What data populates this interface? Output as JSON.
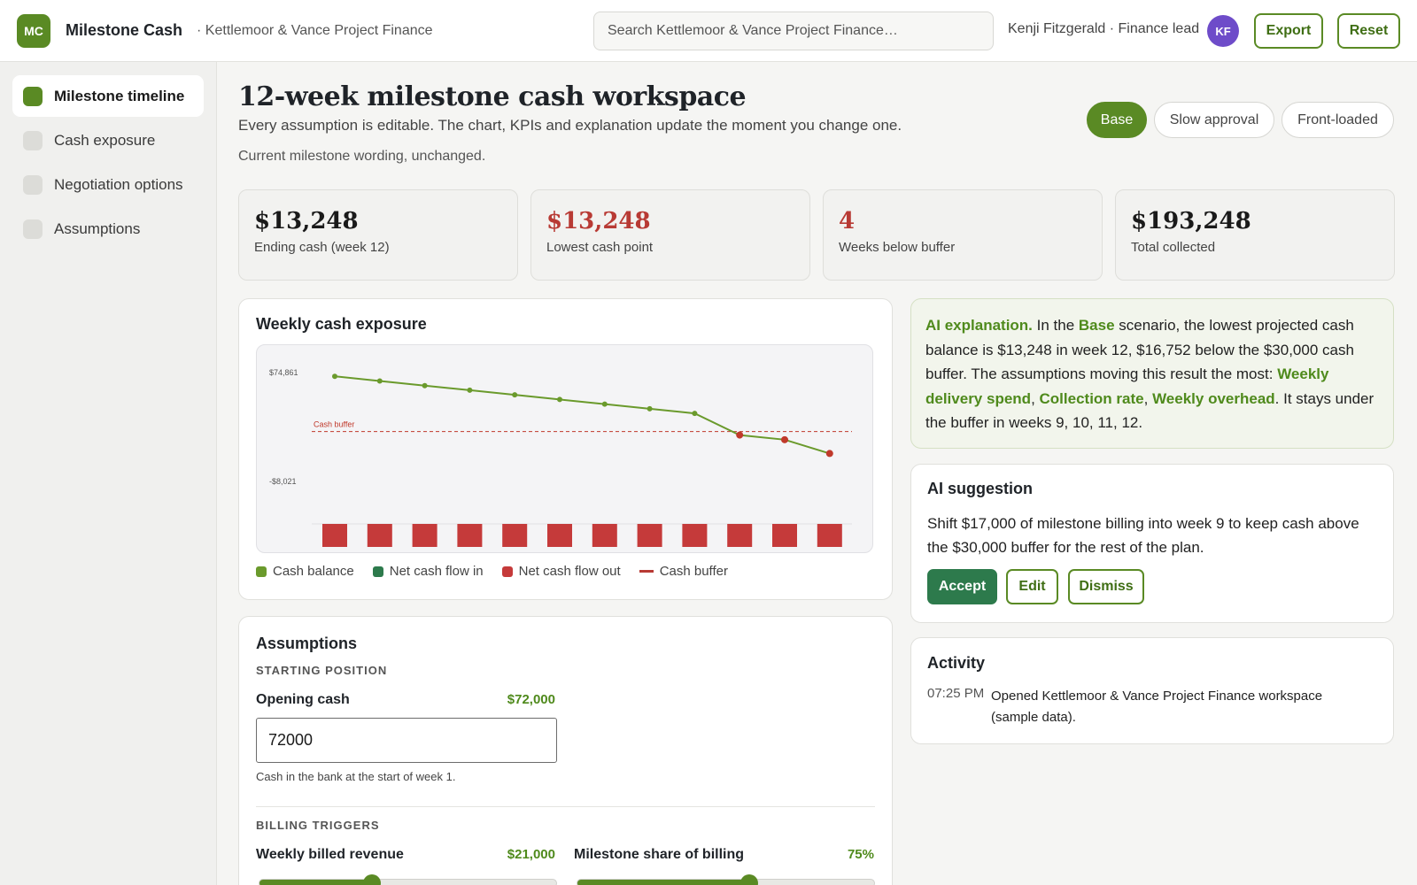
{
  "app": {
    "logo_text": "MC",
    "name": "Milestone Cash",
    "org": "· Kettlemoor & Vance Project Finance",
    "search_placeholder": "Search Kettlemoor & Vance Project Finance…",
    "user": "Kenji Fitzgerald · Finance lead",
    "avatar_initials": "KF",
    "export_label": "Export",
    "reset_label": "Reset"
  },
  "sidebar": {
    "items": [
      {
        "label": "Milestone timeline",
        "active": true
      },
      {
        "label": "Cash exposure",
        "active": false
      },
      {
        "label": "Negotiation options",
        "active": false
      },
      {
        "label": "Assumptions",
        "active": false
      }
    ]
  },
  "header": {
    "title": "12-week milestone cash workspace",
    "subtitle": "Every assumption is editable. The chart, KPIs and explanation update the moment you change one.",
    "note": "Current milestone wording, unchanged."
  },
  "scenarios": [
    {
      "label": "Base",
      "active": true
    },
    {
      "label": "Slow approval",
      "active": false
    },
    {
      "label": "Front-loaded",
      "active": false
    }
  ],
  "kpis": [
    {
      "value": "$13,248",
      "label": "Ending cash (week 12)",
      "tone": "normal"
    },
    {
      "value": "$13,248",
      "label": "Lowest cash point",
      "tone": "red"
    },
    {
      "value": "4",
      "label": "Weeks below buffer",
      "tone": "red"
    },
    {
      "value": "$193,248",
      "label": "Total collected",
      "tone": "normal"
    }
  ],
  "chart_card": {
    "title": "Weekly cash exposure",
    "legend": [
      "Cash balance",
      "Net cash flow in",
      "Net cash flow out",
      "Cash buffer"
    ]
  },
  "chart_data": {
    "type": "line",
    "title": "Weekly cash exposure",
    "x": [
      1,
      2,
      3,
      4,
      5,
      6,
      7,
      8,
      9,
      10,
      11,
      12
    ],
    "series": [
      {
        "name": "Cash balance",
        "values": [
          72000,
          68477,
          64955,
          61432,
          57909,
          54386,
          50864,
          47341,
          43818,
          27295,
          23773,
          13248
        ]
      },
      {
        "name": "Net cash flow out",
        "values": [
          -3523,
          -3523,
          -3523,
          -3523,
          -3523,
          -3523,
          -3523,
          -3523,
          -3523,
          -3523,
          -3523,
          -3523
        ]
      }
    ],
    "buffer": {
      "name": "Cash buffer",
      "value": 30000
    },
    "ytick_labels": [
      "$74,861",
      "-$8,021"
    ],
    "ylim": [
      -8021,
      74861
    ],
    "colors": {
      "balance": "#6a9a2c",
      "below": "#c0392b",
      "out": "#c53a3a",
      "in": "#2d7a4c",
      "buffer": "#c0392b"
    },
    "grid": false,
    "legend_position": "bottom-left"
  },
  "ai_explanation": {
    "lead": "AI explanation.",
    "t1": " In the ",
    "scenario": "Base",
    "t2": " scenario, the lowest projected cash balance is $13,248 in week 12, $16,752 below the $30,000 cash buffer. The assumptions moving this result the most: ",
    "d1": "Weekly delivery spend",
    "sep1": ", ",
    "d2": "Collection rate",
    "sep2": ", ",
    "d3": "Weekly overhead",
    "t3": ". It stays under the buffer in weeks 9, 10, 11, 12."
  },
  "ai_suggestion": {
    "title": "AI suggestion",
    "text": "Shift $17,000 of milestone billing into week 9 to keep cash above the $30,000 buffer for the rest of the plan.",
    "accept": "Accept",
    "edit": "Edit",
    "dismiss": "Dismiss"
  },
  "activity": {
    "title": "Activity",
    "items": [
      {
        "time": "07:25 PM",
        "text": "Opened Kettlemoor & Vance Project Finance workspace (sample data)."
      }
    ]
  },
  "assumptions": {
    "title": "Assumptions",
    "starting_label": "STARTING POSITION",
    "opening_cash_label": "Opening cash",
    "opening_cash_display": "$72,000",
    "opening_cash_value": "72000",
    "opening_cash_help": "Cash in the bank at the start of week 1.",
    "billing_label": "BILLING TRIGGERS",
    "weekly_billed_label": "Weekly billed revenue",
    "weekly_billed_display": "$21,000",
    "weekly_billed_fraction": 0.38,
    "milestone_share_label": "Milestone share of billing",
    "milestone_share_display": "75%",
    "milestone_share_fraction": 0.58
  }
}
